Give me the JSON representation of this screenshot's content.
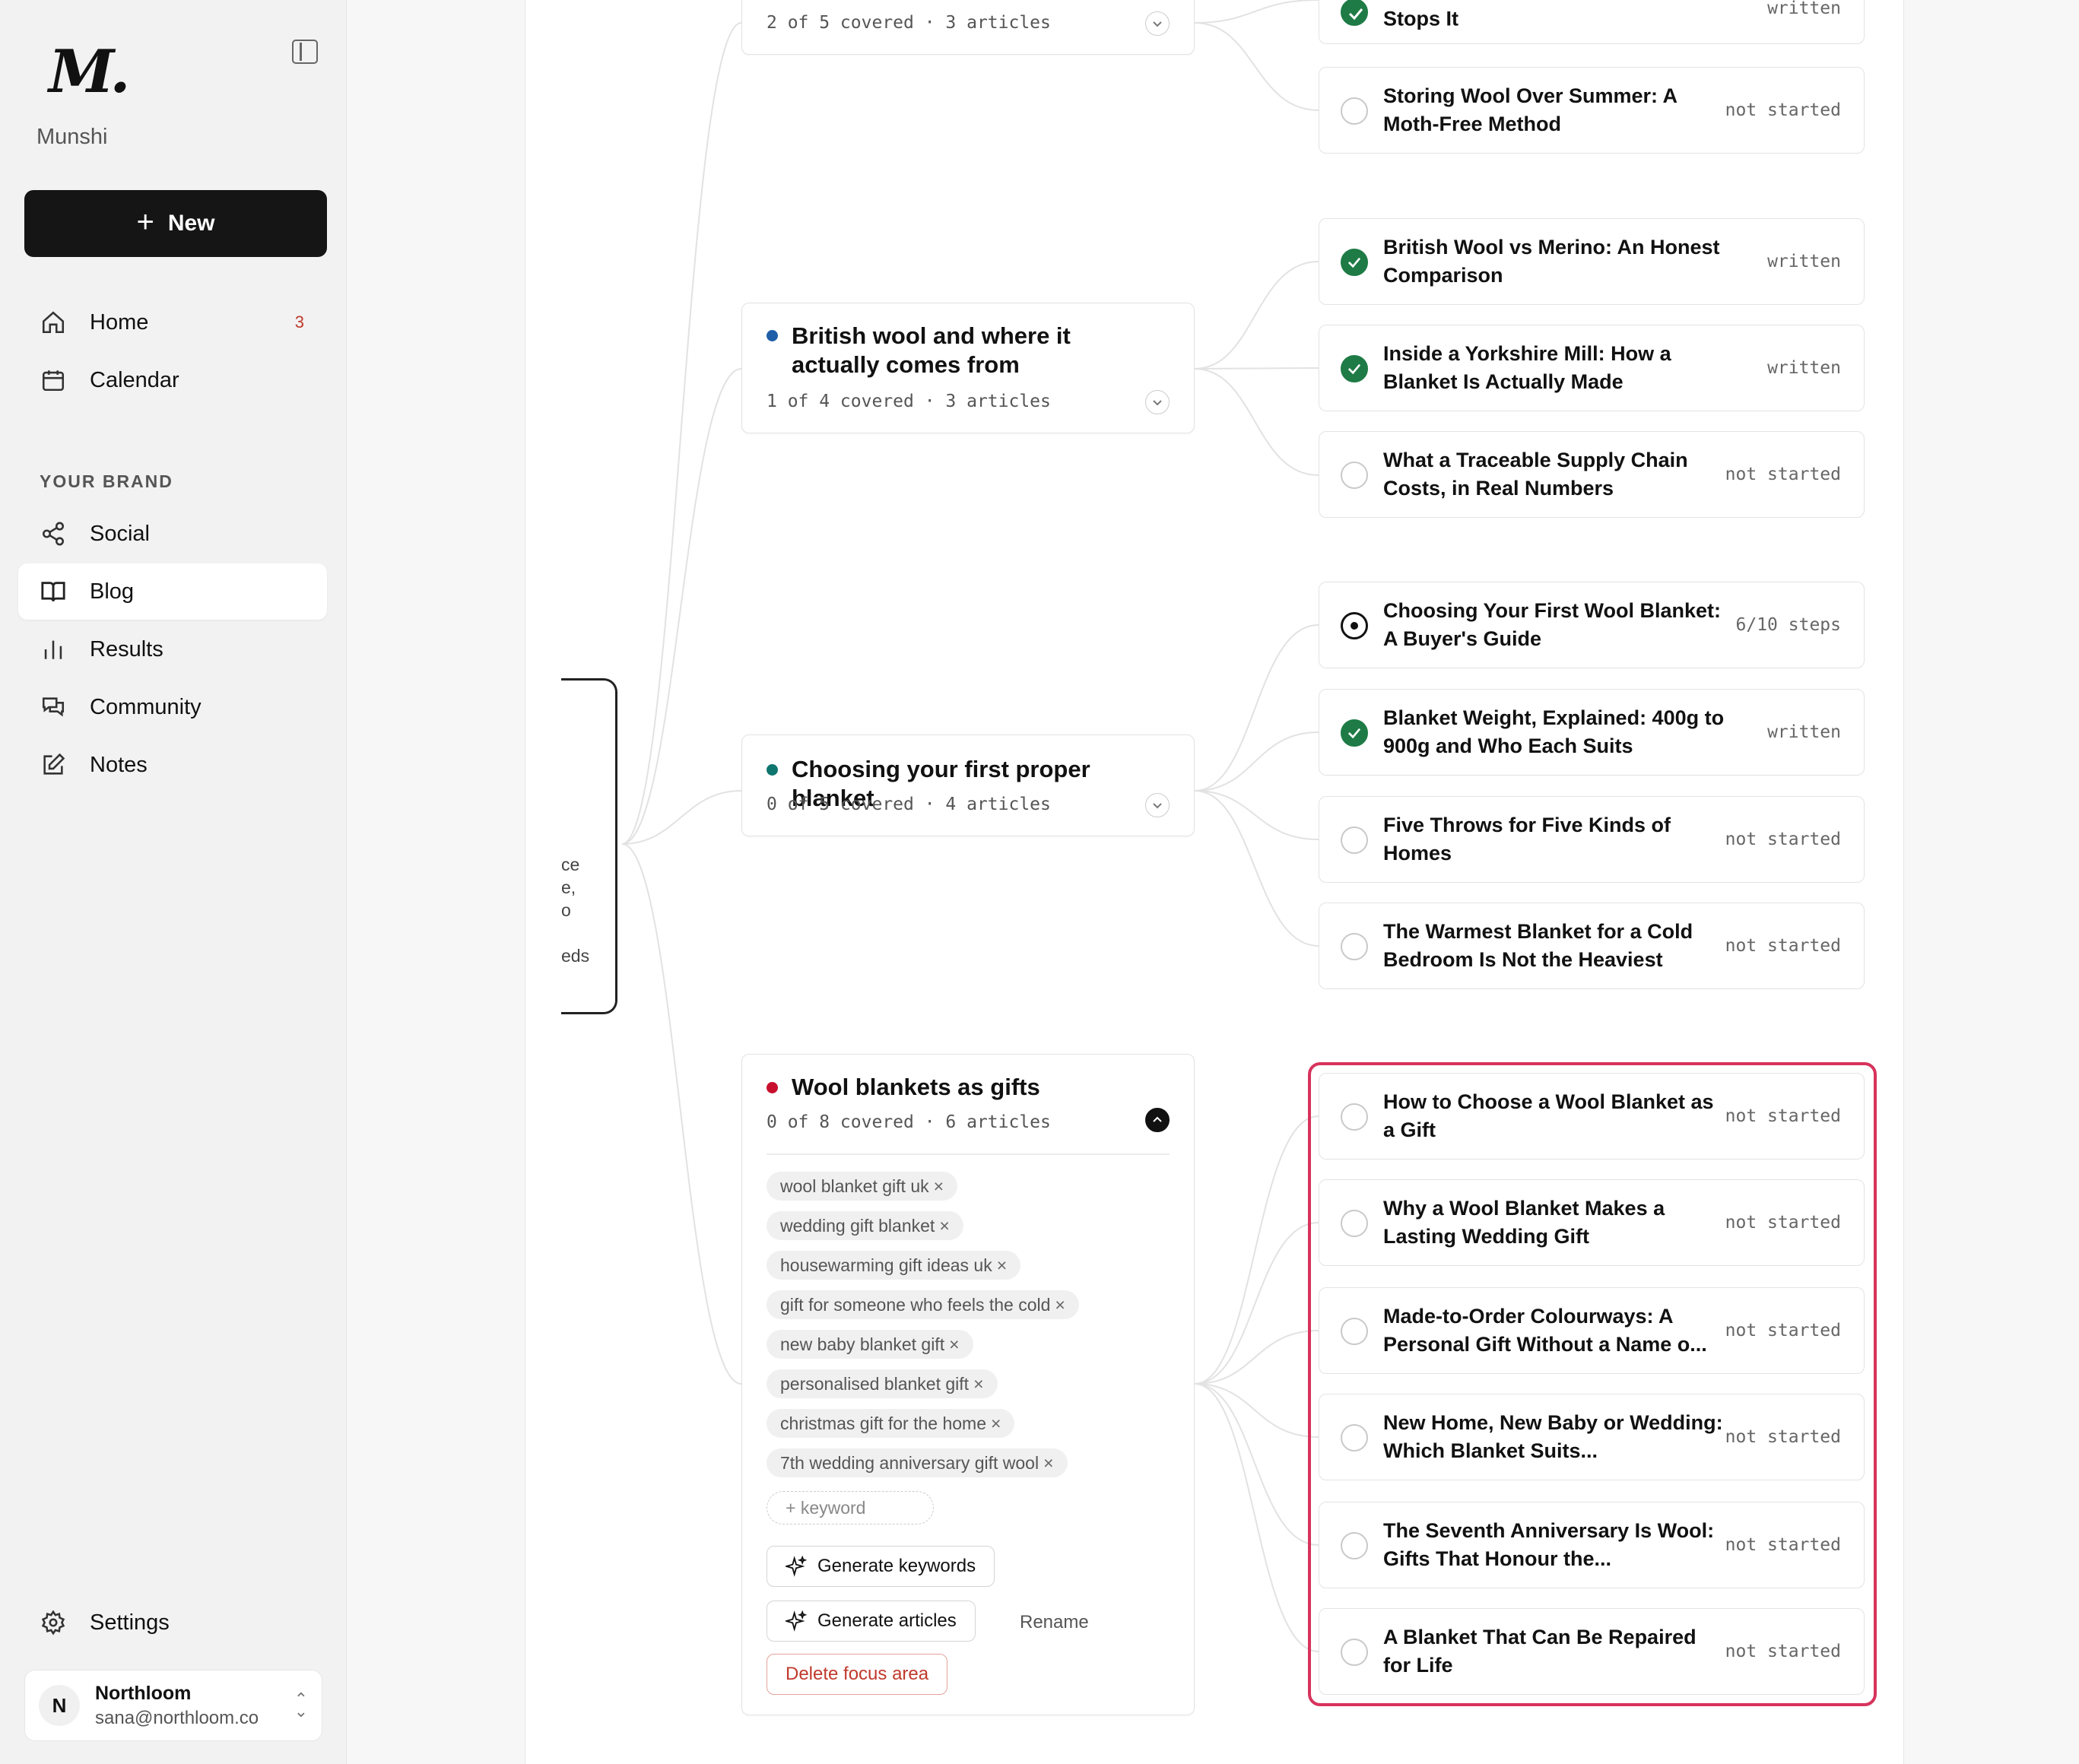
{
  "app": {
    "brand": "Munshi",
    "new_label": "New"
  },
  "nav": {
    "primary": [
      {
        "label": "Home",
        "badge": "3",
        "icon": "home-icon"
      },
      {
        "label": "Calendar",
        "icon": "calendar-icon"
      }
    ],
    "section_label": "YOUR BRAND",
    "brand": [
      {
        "label": "Social",
        "icon": "share-icon"
      },
      {
        "label": "Blog",
        "icon": "book-icon",
        "active": true
      },
      {
        "label": "Results",
        "icon": "bar-chart-icon"
      },
      {
        "label": "Community",
        "icon": "chat-icon"
      },
      {
        "label": "Notes",
        "icon": "edit-icon"
      }
    ],
    "settings": "Settings"
  },
  "user": {
    "initial": "N",
    "name": "Northloom",
    "email": "sana@northloom.co"
  },
  "root_fragments": [
    "ce",
    "e,",
    "o",
    "eds"
  ],
  "focus_areas": [
    {
      "title": "",
      "meta": "2 of 5 covered · 3 articles"
    },
    {
      "title": "British wool and where it actually comes from",
      "meta": "1 of 4 covered · 3 articles",
      "dot_color": "#1f5fa8"
    },
    {
      "title": "Choosing your first proper blanket",
      "meta": "0 of 5 covered · 4 articles",
      "dot_color": "#0f766e"
    },
    {
      "title": "Wool blankets as gifts",
      "meta": "0 of 8 covered · 6 articles",
      "dot_color": "#c8102e",
      "keywords": [
        "wool blanket gift uk",
        "wedding gift blanket",
        "housewarming gift ideas uk",
        "gift for someone who feels the cold",
        "new baby blanket gift",
        "personalised blanket gift",
        "christmas gift for the home",
        "7th wedding anniversary gift wool"
      ],
      "add_keyword": "+ keyword",
      "generate_keywords": "Generate keywords",
      "generate_articles": "Generate articles",
      "rename": "Rename",
      "delete": "Delete focus area"
    }
  ],
  "articles": [
    {
      "title": "Stops It",
      "status": "written",
      "state": "done"
    },
    {
      "title": "Storing Wool Over Summer: A Moth-Free Method",
      "status": "not started",
      "state": "todo"
    },
    {
      "title": "British Wool vs Merino: An Honest Comparison",
      "status": "written",
      "state": "done"
    },
    {
      "title": "Inside a Yorkshire Mill: How a Blanket Is Actually Made",
      "status": "written",
      "state": "done"
    },
    {
      "title": "What a Traceable Supply Chain Costs, in Real Numbers",
      "status": "not started",
      "state": "todo"
    },
    {
      "title": "Choosing Your First Wool Blanket: A Buyer's Guide",
      "status": "6/10 steps",
      "state": "progress"
    },
    {
      "title": "Blanket Weight, Explained: 400g to 900g and Who Each Suits",
      "status": "written",
      "state": "done"
    },
    {
      "title": "Five Throws for Five Kinds of Homes",
      "status": "not started",
      "state": "todo"
    },
    {
      "title": "The Warmest Blanket for a Cold Bedroom Is Not the Heaviest",
      "status": "not started",
      "state": "todo"
    },
    {
      "title": "How to Choose a Wool Blanket as a Gift",
      "status": "not started",
      "state": "todo"
    },
    {
      "title": "Why a Wool Blanket Makes a Lasting Wedding Gift",
      "status": "not started",
      "state": "todo"
    },
    {
      "title": "Made-to-Order Colourways: A Personal Gift Without a Name o...",
      "status": "not started",
      "state": "todo"
    },
    {
      "title": "New Home, New Baby or Wedding: Which Blanket Suits...",
      "status": "not started",
      "state": "todo"
    },
    {
      "title": "The Seventh Anniversary Is Wool: Gifts That Honour the...",
      "status": "not started",
      "state": "todo"
    },
    {
      "title": "A Blanket That Can Be Repaired for Life",
      "status": "not started",
      "state": "todo"
    }
  ]
}
